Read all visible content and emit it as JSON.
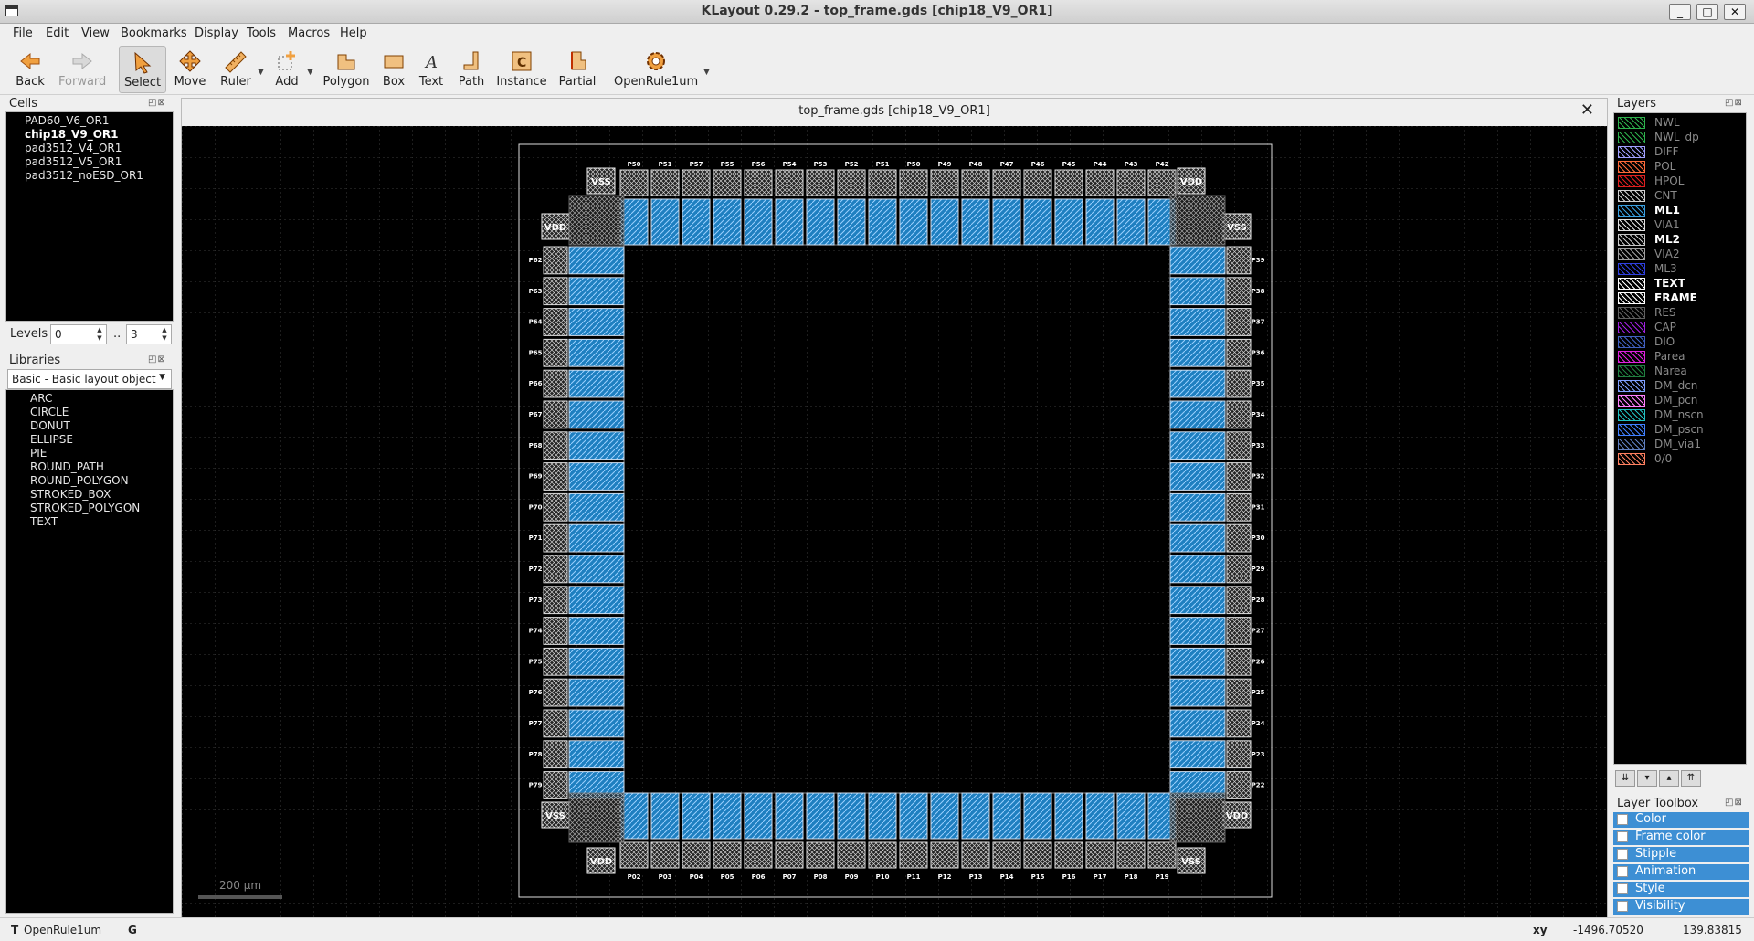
{
  "window": {
    "title": "KLayout 0.29.2 - top_frame.gds [chip18_V9_OR1]",
    "minimize": "_",
    "maximize": "□",
    "close": "✕"
  },
  "menu": [
    "File",
    "Edit",
    "View",
    "Bookmarks",
    "Display",
    "Tools",
    "Macros",
    "Help"
  ],
  "toolbar": {
    "back": "Back",
    "forward": "Forward",
    "select": "Select",
    "move": "Move",
    "ruler": "Ruler",
    "add": "Add",
    "polygon": "Polygon",
    "box": "Box",
    "text": "Text",
    "path": "Path",
    "instance": "Instance",
    "partial": "Partial",
    "tech": "OpenRule1um"
  },
  "cells": {
    "title": "Cells",
    "items": [
      "PAD60_V6_OR1",
      "chip18_V9_OR1",
      "pad3512_V4_OR1",
      "pad3512_V5_OR1",
      "pad3512_noESD_OR1"
    ],
    "selected": "chip18_V9_OR1"
  },
  "levels": {
    "label": "Levels",
    "from": "0",
    "sep": "..",
    "to": "3"
  },
  "libraries": {
    "title": "Libraries",
    "selected": "Basic - Basic layout object",
    "items": [
      "ARC",
      "CIRCLE",
      "DONUT",
      "ELLIPSE",
      "PIE",
      "ROUND_PATH",
      "ROUND_POLYGON",
      "STROKED_BOX",
      "STROKED_POLYGON",
      "TEXT"
    ]
  },
  "document": {
    "title": "top_frame.gds [chip18_V9_OR1]",
    "close": "✕"
  },
  "layout": {
    "top_labels": [
      "P50",
      "P51",
      "P57",
      "P55",
      "P56",
      "P54",
      "P53",
      "P52",
      "P51",
      "P50",
      "P49",
      "P48",
      "P47",
      "P46",
      "P45",
      "P44",
      "P43",
      "P42"
    ],
    "bottom_labels": [
      "P02",
      "P03",
      "P04",
      "P05",
      "P06",
      "P07",
      "P08",
      "P09",
      "P10",
      "P11",
      "P12",
      "P13",
      "P14",
      "P15",
      "P16",
      "P17",
      "P18",
      "P19"
    ],
    "left_labels": [
      "P62",
      "P63",
      "P64",
      "P65",
      "P66",
      "P67",
      "P68",
      "P69",
      "P70",
      "P71",
      "P72",
      "P73",
      "P74",
      "P75",
      "P76",
      "P77",
      "P78",
      "P79"
    ],
    "right_labels": [
      "P39",
      "P38",
      "P37",
      "P36",
      "P35",
      "P34",
      "P33",
      "P32",
      "P31",
      "P30",
      "P29",
      "P28",
      "P27",
      "P26",
      "P25",
      "P24",
      "P23",
      "P22"
    ],
    "corner_top_left": "VSS",
    "corner_top_right": "VDD",
    "side_top_left": "VDD",
    "side_top_right": "VSS",
    "side_bottom_left": "VSS",
    "side_bottom_right": "VDD",
    "corner_bottom_left": "VDD",
    "corner_bottom_right": "VSS",
    "scale": "200 µm"
  },
  "layers": {
    "title": "Layers",
    "items": [
      {
        "name": "NWL",
        "color": "#2db14c",
        "bold": false,
        "dim": true
      },
      {
        "name": "NWL_dp",
        "color": "#2db14c",
        "bold": false,
        "dim": true
      },
      {
        "name": "DIFF",
        "color": "#a0a0ff",
        "bold": false,
        "dim": true
      },
      {
        "name": "POL",
        "color": "#ff6a3a",
        "bold": false,
        "dim": true
      },
      {
        "name": "HPOL",
        "color": "#e02020",
        "bold": false,
        "dim": true
      },
      {
        "name": "CNT",
        "color": "#d0d0d0",
        "bold": false,
        "dim": true
      },
      {
        "name": "ML1",
        "color": "#3aa0e0",
        "bold": true,
        "dim": false
      },
      {
        "name": "VIA1",
        "color": "#e0e0e0",
        "bold": false,
        "dim": true
      },
      {
        "name": "ML2",
        "color": "#c8c8c8",
        "bold": true,
        "dim": false
      },
      {
        "name": "VIA2",
        "color": "#a0a0a0",
        "bold": false,
        "dim": true
      },
      {
        "name": "ML3",
        "color": "#3040e0",
        "bold": false,
        "dim": true
      },
      {
        "name": "TEXT",
        "color": "#ffffff",
        "bold": true,
        "dim": false
      },
      {
        "name": "FRAME",
        "color": "#ffffff",
        "bold": true,
        "dim": false
      },
      {
        "name": "RES",
        "color": "#606060",
        "bold": false,
        "dim": true
      },
      {
        "name": "CAP",
        "color": "#a020e0",
        "bold": false,
        "dim": true
      },
      {
        "name": "DIO",
        "color": "#4060c0",
        "bold": false,
        "dim": true
      },
      {
        "name": "Parea",
        "color": "#e020e0",
        "bold": false,
        "dim": true
      },
      {
        "name": "Narea",
        "color": "#208040",
        "bold": false,
        "dim": true
      },
      {
        "name": "DM_dcn",
        "color": "#80a0ff",
        "bold": false,
        "dim": true
      },
      {
        "name": "DM_pcn",
        "color": "#ff80ff",
        "bold": false,
        "dim": true
      },
      {
        "name": "DM_nscn",
        "color": "#20c0c0",
        "bold": false,
        "dim": true
      },
      {
        "name": "DM_pscn",
        "color": "#4080ff",
        "bold": false,
        "dim": true
      },
      {
        "name": "DM_via1",
        "color": "#6080c0",
        "bold": false,
        "dim": true
      },
      {
        "name": "0/0",
        "color": "#ff8060",
        "bold": false,
        "dim": true
      }
    ]
  },
  "layer_buttons": [
    "⇊",
    "▾",
    "▴",
    "⇈"
  ],
  "toolbox": {
    "title": "Layer Toolbox",
    "items": [
      "Color",
      "Frame color",
      "Stipple",
      "Animation",
      "Style",
      "Visibility"
    ]
  },
  "status": {
    "mode": "T",
    "tech": "OpenRule1um",
    "grid": "G",
    "coord_label": "xy",
    "x": "-1496.70520",
    "y": "139.83815"
  }
}
